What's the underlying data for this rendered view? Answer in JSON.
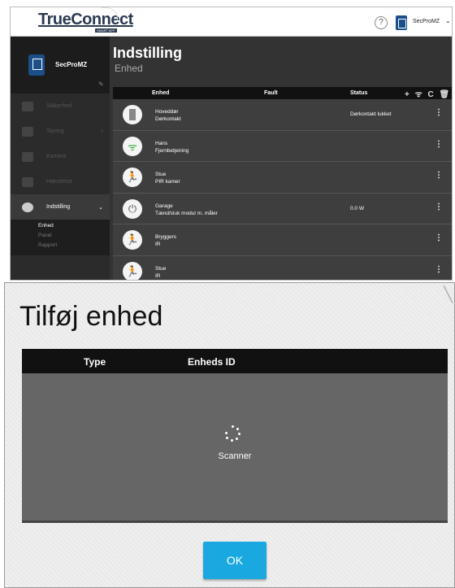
{
  "header": {
    "logo": "TrueConnect",
    "logo_sub": "SMART APP",
    "help": "?",
    "user": "SecProMZ",
    "chevron": "⌄"
  },
  "sidebar": {
    "profile_name": "SecProMZ",
    "items": [
      {
        "label": "Sikkerhed",
        "icon": "shield-icon"
      },
      {
        "label": "Styring",
        "icon": "sliders-icon",
        "chevron": "›"
      },
      {
        "label": "Kamera",
        "icon": "camera-icon"
      },
      {
        "label": "Hændelse",
        "icon": "list-icon"
      },
      {
        "label": "Indstilling",
        "icon": "gear-icon",
        "chevron": "⌄"
      }
    ],
    "sub_items": [
      {
        "label": "Enhed"
      },
      {
        "label": "Panel"
      },
      {
        "label": "Rapport"
      }
    ]
  },
  "main": {
    "title": "Indstilling",
    "subtitle": "Enhed",
    "columns": {
      "enhed": "Enhed",
      "fault": "Fault",
      "status": "Status"
    },
    "tools": "+ ᯤ C 🗑",
    "devices": [
      {
        "name": "Hoveddør",
        "type": "Dørkontakt",
        "status": "Dørkontakt lukket",
        "icon": "door-contact-icon"
      },
      {
        "name": "Hans",
        "type": "Fjernbetjening",
        "status": "",
        "icon": "remote-icon"
      },
      {
        "name": "Stue",
        "type": "PIR kamer",
        "status": "",
        "icon": "pir-camera-icon"
      },
      {
        "name": "Garage",
        "type": "Tænd/sluk modul m. måler",
        "status": "0.0 W",
        "icon": "power-module-icon"
      },
      {
        "name": "Bryggers",
        "type": "IR",
        "status": "",
        "icon": "ir-motion-icon"
      },
      {
        "name": "Stue",
        "type": "IR",
        "status": "",
        "icon": "ir-motion-icon"
      }
    ]
  },
  "dialog": {
    "title": "Tilføj enhed",
    "col_type": "Type",
    "col_id": "Enheds ID",
    "scanning": "Scanner",
    "ok": "OK",
    "close": "╲"
  }
}
